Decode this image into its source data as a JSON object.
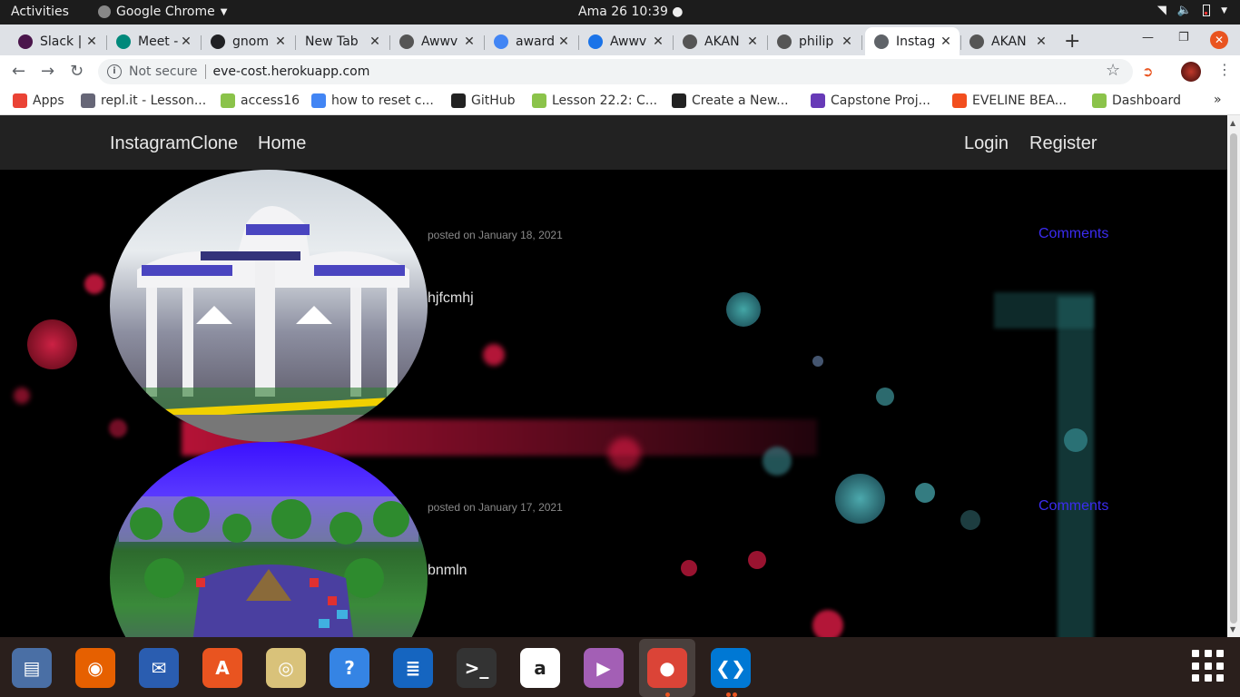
{
  "topbar": {
    "activities": "Activities",
    "app_name": "Google Chrome",
    "app_menu_icon": "chevron-down-icon",
    "clock": "Ama 26  10:39 ●",
    "tray_icons": [
      "wifi-icon",
      "volume-icon",
      "battery-icon",
      "chevron-down-icon"
    ]
  },
  "tabs": [
    {
      "title": "Slack |",
      "icon": "slack-icon",
      "color": "#4a154b",
      "active": false
    },
    {
      "title": "Meet -",
      "icon": "meet-icon",
      "color": "#00897b",
      "active": false
    },
    {
      "title": "gnom",
      "icon": "bracket-icon",
      "color": "#202124",
      "active": false
    },
    {
      "title": "New Tab",
      "icon": "",
      "color": "",
      "active": false
    },
    {
      "title": "Awwv",
      "icon": "globe-icon",
      "color": "#555",
      "active": false
    },
    {
      "title": "award",
      "icon": "google-icon",
      "color": "#4285f4",
      "active": false
    },
    {
      "title": "Awwv",
      "icon": "loading-icon",
      "color": "#1a73e8",
      "active": false
    },
    {
      "title": "AKAN",
      "icon": "globe-icon",
      "color": "#555",
      "active": false
    },
    {
      "title": "philip",
      "icon": "github-icon",
      "color": "#555",
      "active": false
    },
    {
      "title": "Instag",
      "icon": "globe-icon",
      "color": "#5f6368",
      "active": true
    },
    {
      "title": "AKAN",
      "icon": "globe-icon",
      "color": "#555",
      "active": false
    }
  ],
  "toolbar": {
    "not_secure": "Not secure",
    "url": "eve-cost.herokuapp.com"
  },
  "bookmarks": [
    {
      "label": "Apps",
      "icon": "apps-grid-icon",
      "color": "#ea4335"
    },
    {
      "label": "repl.it - Lesson...",
      "icon": "replit-icon",
      "color": "#667"
    },
    {
      "label": "access16",
      "icon": "tree-icon",
      "color": "#8bc34a"
    },
    {
      "label": "how to reset c...",
      "icon": "google-icon",
      "color": "#4285f4"
    },
    {
      "label": "GitHub",
      "icon": "github-icon",
      "color": "#222"
    },
    {
      "label": "Lesson 22.2: C...",
      "icon": "tree-icon",
      "color": "#8bc34a"
    },
    {
      "label": "Create a New...",
      "icon": "github-icon",
      "color": "#222"
    },
    {
      "label": "Capstone Proj...",
      "icon": "forms-icon",
      "color": "#673ab7"
    },
    {
      "label": "EVELINE BEA...",
      "icon": "figma-icon",
      "color": "#f24e1e"
    },
    {
      "label": "Dashboard",
      "icon": "tree-icon",
      "color": "#8bc34a"
    }
  ],
  "bookmarks_more": "»",
  "app": {
    "brand": "InstagramClone",
    "home": "Home",
    "login": "Login",
    "register": "Register"
  },
  "posts": [
    {
      "date": "posted on January 18, 2021",
      "comments": "Comments",
      "caption": "hjfcmhj",
      "image": "kenyatta-university-gate-image"
    },
    {
      "date": "posted on January 17, 2021",
      "comments": "Comments",
      "caption": "bnmln",
      "image": "resort-pool-aerial-image"
    }
  ],
  "dock": [
    {
      "name": "files-icon",
      "color": "#4a6fa5",
      "glyph": "▤"
    },
    {
      "name": "firefox-icon",
      "color": "#e66000",
      "glyph": "◉"
    },
    {
      "name": "thunderbird-icon",
      "color": "#2a5db0",
      "glyph": "✉"
    },
    {
      "name": "software-center-icon",
      "color": "#e95420",
      "glyph": "A"
    },
    {
      "name": "rhythmbox-icon",
      "color": "#d9c27a",
      "glyph": "◎"
    },
    {
      "name": "help-icon",
      "color": "#3584e4",
      "glyph": "?"
    },
    {
      "name": "writer-icon",
      "color": "#1565c0",
      "glyph": "≣"
    },
    {
      "name": "terminal-icon",
      "color": "#333",
      "glyph": ">_"
    },
    {
      "name": "amazon-icon",
      "color": "#fff",
      "glyph": "a"
    },
    {
      "name": "video-icon",
      "color": "#a35fb5",
      "glyph": "▶"
    },
    {
      "name": "chrome-icon",
      "color": "#db4437",
      "glyph": "●"
    },
    {
      "name": "vscode-icon",
      "color": "#0078d4",
      "glyph": "❮❯"
    }
  ]
}
